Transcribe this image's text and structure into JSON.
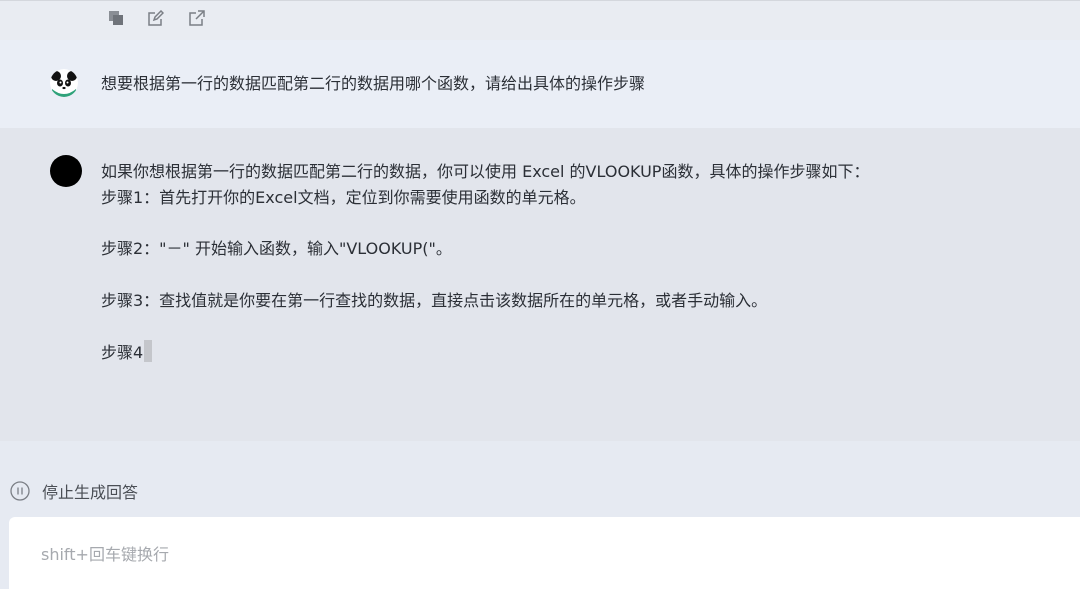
{
  "toolbar": {
    "icons": [
      "copy-icon",
      "edit-icon",
      "share-icon"
    ]
  },
  "user_message": {
    "avatar": "panda-avatar-icon",
    "text": "想要根据第一行的数据匹配第二行的数据用哪个函数，请给出具体的操作步骤"
  },
  "ai_message": {
    "avatar": "assistant-avatar",
    "intro": "如果你想根据第一行的数据匹配第二行的数据，你可以使用 Excel 的VLOOKUP函数，具体的操作步骤如下：",
    "step1": "步骤1：首先打开你的Excel文档，定位到你需要使用函数的单元格。",
    "step2": "步骤2：\"－\" 开始输入函数，输入\"VLOOKUP(\"。",
    "step3": "步骤3：查找值就是你要在第一行查找的数据，直接点击该数据所在的单元格，或者手动输入。",
    "step4_partial": "步骤4"
  },
  "stop_generation": {
    "icon": "pause-circle-icon",
    "label": "停止生成回答"
  },
  "input": {
    "value": "",
    "placeholder": "shift+回车键换行"
  },
  "colors": {
    "user_bg": "#eaeef6",
    "ai_bg": "#e2e5ec",
    "page_bg": "#e6eaf2",
    "input_bg": "#ffffff",
    "text": "#2b2f36",
    "placeholder": "#a6a9ae"
  }
}
